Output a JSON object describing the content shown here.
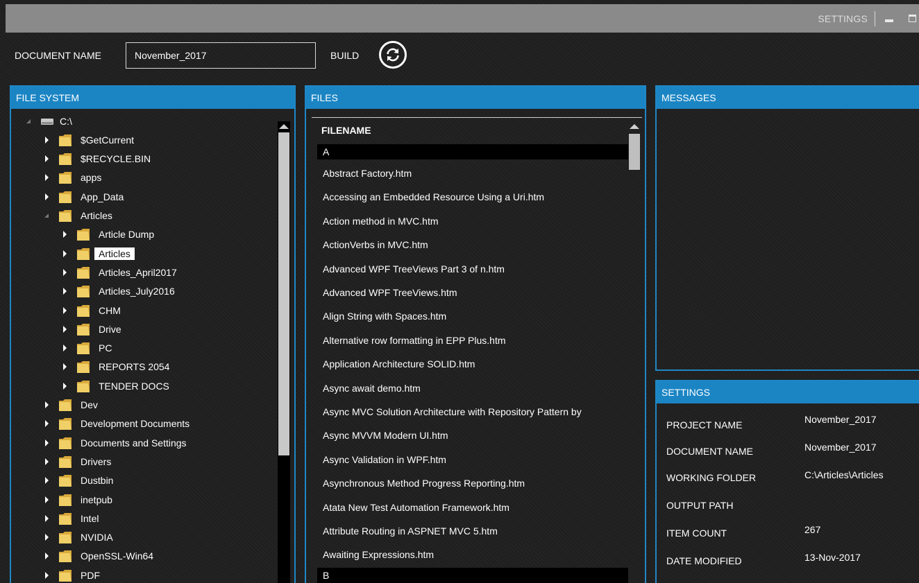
{
  "titlebar": {
    "settings_label": "SETTINGS"
  },
  "toolbar": {
    "document_name_label": "DOCUMENT NAME",
    "document_name_value": "November_2017",
    "build_label": "BUILD"
  },
  "file_system": {
    "header": "FILE SYSTEM",
    "items": [
      {
        "label": "C:\\",
        "level": 0,
        "state": "expanded",
        "kind": "drive"
      },
      {
        "label": "$GetCurrent",
        "level": 1,
        "state": "collapsed"
      },
      {
        "label": "$RECYCLE.BIN",
        "level": 1,
        "state": "collapsed"
      },
      {
        "label": "apps",
        "level": 1,
        "state": "collapsed"
      },
      {
        "label": "App_Data",
        "level": 1,
        "state": "collapsed"
      },
      {
        "label": "Articles",
        "level": 1,
        "state": "expanded"
      },
      {
        "label": "Article Dump",
        "level": 2,
        "state": "collapsed"
      },
      {
        "label": "Articles",
        "level": 2,
        "state": "collapsed",
        "selected": true
      },
      {
        "label": "Articles_April2017",
        "level": 2,
        "state": "collapsed"
      },
      {
        "label": "Articles_July2016",
        "level": 2,
        "state": "collapsed"
      },
      {
        "label": "CHM",
        "level": 2,
        "state": "collapsed"
      },
      {
        "label": "Drive",
        "level": 2,
        "state": "collapsed"
      },
      {
        "label": "PC",
        "level": 2,
        "state": "collapsed"
      },
      {
        "label": "REPORTS 2054",
        "level": 2,
        "state": "collapsed"
      },
      {
        "label": "TENDER DOCS",
        "level": 2,
        "state": "collapsed"
      },
      {
        "label": "Dev",
        "level": 1,
        "state": "collapsed"
      },
      {
        "label": "Development Documents",
        "level": 1,
        "state": "collapsed"
      },
      {
        "label": "Documents and Settings",
        "level": 1,
        "state": "collapsed"
      },
      {
        "label": "Drivers",
        "level": 1,
        "state": "collapsed"
      },
      {
        "label": "Dustbin",
        "level": 1,
        "state": "collapsed"
      },
      {
        "label": "inetpub",
        "level": 1,
        "state": "collapsed"
      },
      {
        "label": "Intel",
        "level": 1,
        "state": "collapsed"
      },
      {
        "label": "NVIDIA",
        "level": 1,
        "state": "collapsed"
      },
      {
        "label": "OpenSSL-Win64",
        "level": 1,
        "state": "collapsed"
      },
      {
        "label": "PDF",
        "level": 1,
        "state": "collapsed"
      }
    ]
  },
  "files": {
    "header": "FILES",
    "column_header": "FILENAME",
    "rows": [
      {
        "type": "group",
        "label": "A"
      },
      {
        "type": "file",
        "label": "Abstract Factory.htm"
      },
      {
        "type": "file",
        "label": "Accessing an Embedded Resource Using a Uri.htm"
      },
      {
        "type": "file",
        "label": "Action method in MVC.htm"
      },
      {
        "type": "file",
        "label": "ActionVerbs in MVC.htm"
      },
      {
        "type": "file",
        "label": "Advanced WPF TreeViews Part 3 of n.htm"
      },
      {
        "type": "file",
        "label": "Advanced WPF TreeViews.htm"
      },
      {
        "type": "file",
        "label": "Align String with Spaces.htm"
      },
      {
        "type": "file",
        "label": "Alternative row formatting in EPP Plus.htm"
      },
      {
        "type": "file",
        "label": "Application Architecture SOLID.htm"
      },
      {
        "type": "file",
        "label": "Async await demo.htm"
      },
      {
        "type": "file",
        "label": "Async MVC Solution Architecture with Repository Pattern by"
      },
      {
        "type": "file",
        "label": "Async MVVM Modern UI.htm"
      },
      {
        "type": "file",
        "label": "Async Validation in WPF.htm"
      },
      {
        "type": "file",
        "label": "Asynchronous Method Progress Reporting.htm"
      },
      {
        "type": "file",
        "label": "Atata New Test Automation Framework.htm"
      },
      {
        "type": "file",
        "label": "Attribute Routing in ASPNET MVC 5.htm"
      },
      {
        "type": "file",
        "label": "Awaiting Expressions.htm"
      },
      {
        "type": "group",
        "label": "B"
      }
    ]
  },
  "messages": {
    "header": "MESSAGES"
  },
  "settings": {
    "header": "SETTINGS",
    "rows": [
      {
        "label": "PROJECT NAME",
        "value": "November_2017"
      },
      {
        "label": "DOCUMENT NAME",
        "value": "November_2017"
      },
      {
        "label": "WORKING FOLDER",
        "value": "C:\\Articles\\Articles"
      },
      {
        "label": "OUTPUT PATH",
        "value": ""
      },
      {
        "label": "ITEM COUNT",
        "value": "267"
      },
      {
        "label": "DATE MODIFIED",
        "value": "13-Nov-2017"
      }
    ]
  },
  "colors": {
    "accent": "#1b85c4",
    "titlebar": "#8a8a8a",
    "background": "#1b1b1b",
    "folder": "#e8c65a"
  }
}
